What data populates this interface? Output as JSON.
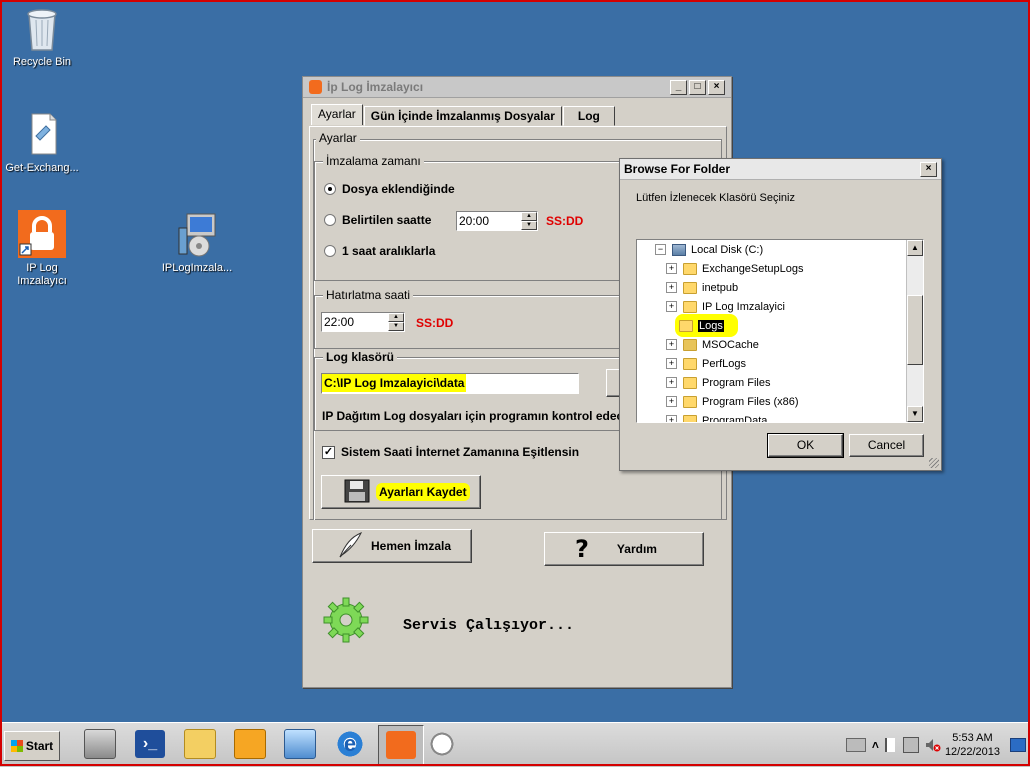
{
  "desktop": {
    "icons": [
      {
        "label": "Recycle Bin"
      },
      {
        "label": "Get-Exchang..."
      },
      {
        "label": "IP Log\nImzalayıcı"
      },
      {
        "label": "IPLogImzala..."
      }
    ]
  },
  "main_window": {
    "title": "İp Log İmzalayıcı",
    "controls": {
      "minimize": "_",
      "maximize": "□",
      "close": "×"
    },
    "tabs": [
      "Ayarlar",
      "Gün İçinde İmzalanmış Dosyalar",
      "Log"
    ],
    "settings_group": "Ayarlar",
    "sign_time": {
      "title": "İmzalama zamanı",
      "options": [
        "Dosya eklendiğinde",
        "Belirtilen saatte",
        "1 saat aralıklarla"
      ],
      "selected_index": 0,
      "time_value": "20:00",
      "time_format": "SS:DD"
    },
    "reminder": {
      "title": "Hatırlatma saati",
      "time_value": "22:00",
      "time_format": "SS:DD"
    },
    "log_folder": {
      "title": "Log klasörü",
      "path": "C:\\IP Log Imzalayici\\data",
      "browse_label": "",
      "note": "IP Dağıtım Log dosyaları için programın kontrol edece"
    },
    "sync_checkbox": {
      "label": "Sistem Saati İnternet Zamanına Eşitlensin",
      "checked": true
    },
    "save_button": "Ayarları Kaydet",
    "sign_now_button": "Hemen İmzala",
    "help_button": "Yardım",
    "help_glyph": "?",
    "status_text": "Servis Çalışıyor..."
  },
  "browse_dialog": {
    "title": "Browse For Folder",
    "close": "×",
    "prompt": "Lütfen İzlenecek Klasörü Seçiniz",
    "tree": [
      {
        "label": "Local Disk (C:)",
        "expander": "−",
        "level": 0
      },
      {
        "label": "ExchangeSetupLogs",
        "expander": "+",
        "level": 1
      },
      {
        "label": "inetpub",
        "expander": "+",
        "level": 1
      },
      {
        "label": "IP Log Imzalayici",
        "expander": "+",
        "level": 1
      },
      {
        "label": "Logs",
        "expander": "",
        "level": 2,
        "selected": true
      },
      {
        "label": "MSOCache",
        "expander": "+",
        "level": 1
      },
      {
        "label": "PerfLogs",
        "expander": "+",
        "level": 1
      },
      {
        "label": "Program Files",
        "expander": "+",
        "level": 1
      },
      {
        "label": "Program Files (x86)",
        "expander": "+",
        "level": 1
      },
      {
        "label": "ProgramData",
        "expander": "+",
        "level": 1
      }
    ],
    "ok_label": "OK",
    "cancel_label": "Cancel"
  },
  "taskbar": {
    "start_label": "Start",
    "clock_time": "5:53 AM",
    "clock_date": "12/22/2013",
    "tray_chevron": "˄"
  },
  "colors": {
    "desktop": "#3a6ea5",
    "highlight": "#ffff00",
    "format_red": "#e00000",
    "app_orange": "#f26b1d"
  }
}
